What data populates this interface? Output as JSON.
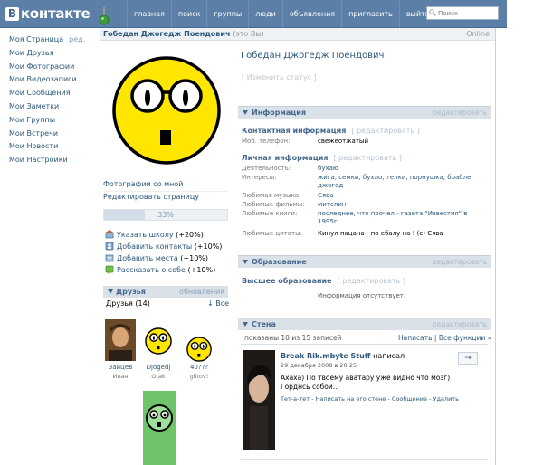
{
  "header": {
    "logo_text": "контакте",
    "logo_letter": "В",
    "nav": [
      "главная",
      "поиск",
      "группы",
      "люди",
      "объявления",
      "пригласить",
      "выйти"
    ],
    "search_placeholder": "Поиск"
  },
  "left_menu": {
    "items": [
      "Моя Страница",
      "Мои Друзья",
      "Мои Фотографии",
      "Мои Видеозаписи",
      "Мои Сообщения",
      "Мои Заметки",
      "Мои Группы",
      "Мои Встречи",
      "Мои Новости",
      "Мои Настройки"
    ],
    "edit_label": "ред."
  },
  "profile": {
    "name_bar": "Гобедан Джогедж Поендович",
    "is_me": "(это Вы)",
    "online": "Online",
    "full_name": "Гобедан Джогедж Поендович",
    "change_status": "[ Изменить статус ]",
    "photos_with_me": "Фотографии со мной",
    "edit_page": "Редактировать страницу",
    "completion": {
      "text": "33%",
      "value": 0.33
    },
    "tips": [
      {
        "icon": "school-icon",
        "link": "Указать школу",
        "bonus": "(+20%)"
      },
      {
        "icon": "contacts-icon",
        "link": "Добавить контакты",
        "bonus": "(+10%)"
      },
      {
        "icon": "places-icon",
        "link": "Добавить места",
        "bonus": "(+10%)"
      },
      {
        "icon": "about-icon",
        "link": "Рассказать о себе",
        "bonus": "(+10%)"
      }
    ]
  },
  "friends": {
    "title": "Друзья",
    "updates": "обновления",
    "count": "Друзья (14)",
    "all": "↓ Все",
    "list": [
      {
        "name": "Зайцев",
        "sub": "Иван"
      },
      {
        "name": "Djogedj",
        "sub": "Otak"
      },
      {
        "name": "40???",
        "sub": "glitov!"
      }
    ]
  },
  "info": {
    "section_title": "Информация",
    "edit": "редактировать",
    "contact_title": "Контактная информация",
    "contact_edit": "[ редактировать ]",
    "phone_label": "Моб. телефон:",
    "phone_value": "свежеотжатый",
    "personal_title": "Личная информация",
    "personal_edit": "[ редактировать ]",
    "activity_label": "Деятельность:",
    "activity_value": "бухаю",
    "interests_label": "Интересы:",
    "interests_value": "жига, семки, бухло, телки, порнушка, брабле, джогед",
    "music_label": "Любимая музыка:",
    "music_value": "Сява",
    "films_label": "Любимые фильмы:",
    "films_value": "митслин",
    "books_label": "Любимые книги:",
    "books_value": "последнее, что прочел - газета \"Известия\" в 1995г",
    "quotes_label": "Любимые цитаты:",
    "quotes_value": "Кинул пацана - по ебалу на ! (с) Сява"
  },
  "education": {
    "section_title": "Образование",
    "edit": "редактировать",
    "higher_title": "Высшее образование",
    "higher_edit": "[ редактировать ]",
    "missing": "Информация отсутствует."
  },
  "wall": {
    "section_title": "Стена",
    "edit": "редактировать",
    "count": "показаны 10 из 15 записей",
    "write": "Написать",
    "all_functions": "Все функции »",
    "post": {
      "author": "Break Rik.mbyte Stuff",
      "wrote": "написал",
      "date": "29 декабря 2008 в 20:25",
      "text": "Ахаха) По твоему аватару уже видно что мозг) Горднсь собой...",
      "actions": "Тет-а-тет - Написать на его стене - Сообщение - Удалить",
      "arrow": "→"
    }
  },
  "colors": {
    "header": "#5b7fa6",
    "link": "#2b587a",
    "section_bg": "#dae1e8",
    "smiley": "#ffe600"
  }
}
